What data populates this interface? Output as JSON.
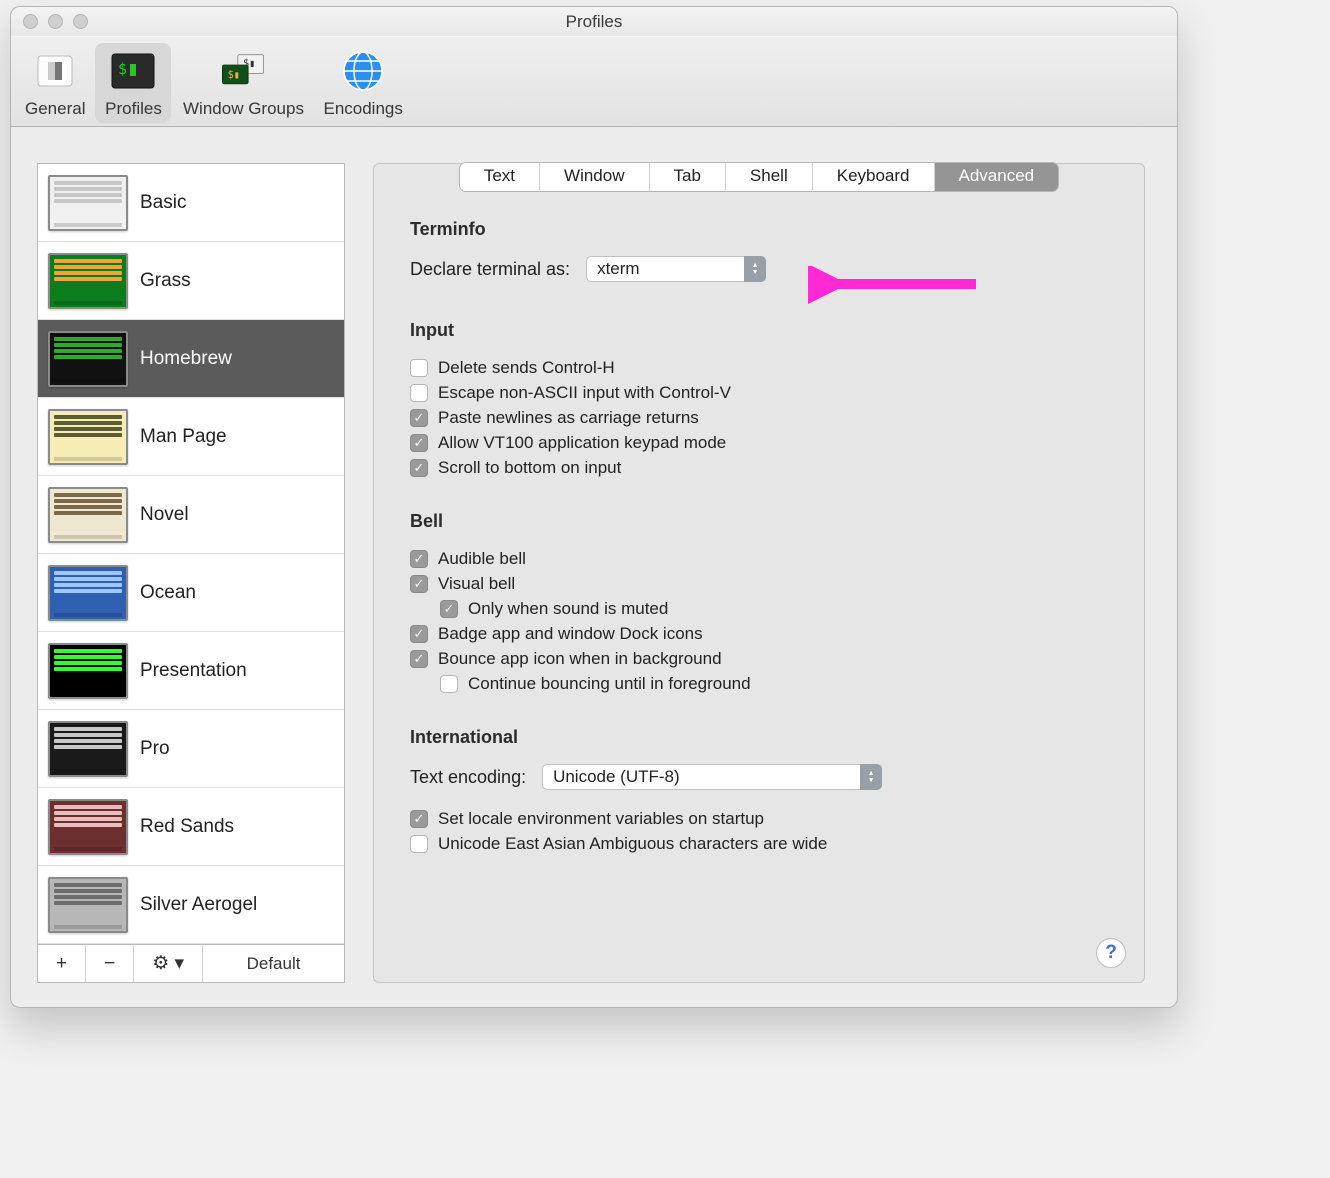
{
  "window": {
    "title": "Profiles"
  },
  "toolbar": {
    "items": [
      {
        "name": "general",
        "label": "General"
      },
      {
        "name": "profiles",
        "label": "Profiles",
        "selected": true
      },
      {
        "name": "window-groups",
        "label": "Window Groups"
      },
      {
        "name": "encodings",
        "label": "Encodings"
      }
    ]
  },
  "sidebar": {
    "profiles": [
      {
        "name": "Basic",
        "bg": "#f0f0f0",
        "rows": [
          "#c6c6c6",
          "#c6c6c6",
          "#c6c6c6",
          "#c6c6c6"
        ]
      },
      {
        "name": "Grass",
        "bg": "#0c7d1c",
        "rows": [
          "#f2a33a",
          "#f2a33a",
          "#f2a33a",
          "#f2a33a"
        ]
      },
      {
        "name": "Homebrew",
        "bg": "#111111",
        "rows": [
          "#2faa2f",
          "#2faa2f",
          "#2faa2f",
          "#2faa2f"
        ],
        "selected": true
      },
      {
        "name": "Man Page",
        "bg": "#f6ecb6",
        "rows": [
          "#5c5c32",
          "#5c5c32",
          "#5c5c32",
          "#5c5c32"
        ]
      },
      {
        "name": "Novel",
        "bg": "#efe7cf",
        "rows": [
          "#7b6a4a",
          "#7b6a4a",
          "#7b6a4a",
          "#7b6a4a"
        ]
      },
      {
        "name": "Ocean",
        "bg": "#2f5fb0",
        "rows": [
          "#9fc6ff",
          "#9fc6ff",
          "#9fc6ff",
          "#9fc6ff"
        ]
      },
      {
        "name": "Presentation",
        "bg": "#000000",
        "rows": [
          "#2fff2f",
          "#2fff2f",
          "#2fff2f",
          "#2fff2f"
        ]
      },
      {
        "name": "Pro",
        "bg": "#1a1a1a",
        "rows": [
          "#c8c8c8",
          "#c8c8c8",
          "#c8c8c8",
          "#c8c8c8"
        ]
      },
      {
        "name": "Red Sands",
        "bg": "#6d2e2e",
        "rows": [
          "#e7bdbd",
          "#e7bdbd",
          "#e7bdbd",
          "#e7bdbd"
        ]
      },
      {
        "name": "Silver Aerogel",
        "bg": "#b7b7b7",
        "rows": [
          "#6d6d6d",
          "#6d6d6d",
          "#6d6d6d",
          "#6d6d6d"
        ]
      }
    ],
    "footer": {
      "add": "+",
      "remove": "−",
      "gear": "⚙︎ ▾",
      "default": "Default"
    }
  },
  "tabs": {
    "items": [
      {
        "label": "Text"
      },
      {
        "label": "Window"
      },
      {
        "label": "Tab"
      },
      {
        "label": "Shell"
      },
      {
        "label": "Keyboard"
      },
      {
        "label": "Advanced",
        "selected": true
      }
    ]
  },
  "settings": {
    "terminfo": {
      "title": "Terminfo",
      "declare_label": "Declare terminal as:",
      "declare_value": "xterm"
    },
    "input": {
      "title": "Input",
      "items": [
        {
          "key": "delete_ctrl_h",
          "label": "Delete sends Control-H",
          "checked": false
        },
        {
          "key": "escape_nonascii",
          "label": "Escape non-ASCII input with Control-V",
          "checked": false
        },
        {
          "key": "paste_cr",
          "label": "Paste newlines as carriage returns",
          "checked": true
        },
        {
          "key": "vt100_keypad",
          "label": "Allow VT100 application keypad mode",
          "checked": true
        },
        {
          "key": "scroll_bottom",
          "label": "Scroll to bottom on input",
          "checked": true
        }
      ]
    },
    "bell": {
      "title": "Bell",
      "items": [
        {
          "key": "audible",
          "label": "Audible bell",
          "checked": true
        },
        {
          "key": "visual",
          "label": "Visual bell",
          "checked": true
        },
        {
          "key": "only_muted",
          "label": "Only when sound is muted",
          "checked": true,
          "indent": 1
        },
        {
          "key": "badge_dock",
          "label": "Badge app and window Dock icons",
          "checked": true
        },
        {
          "key": "bounce_bg",
          "label": "Bounce app icon when in background",
          "checked": true
        },
        {
          "key": "continue_bounce",
          "label": "Continue bouncing until in foreground",
          "checked": false,
          "indent": 1
        }
      ]
    },
    "international": {
      "title": "International",
      "encoding_label": "Text encoding:",
      "encoding_value": "Unicode (UTF-8)",
      "items": [
        {
          "key": "set_locale",
          "label": "Set locale environment variables on startup",
          "checked": true
        },
        {
          "key": "ea_wide",
          "label": "Unicode East Asian Ambiguous characters are wide",
          "checked": false
        }
      ]
    }
  },
  "help_label": "?"
}
